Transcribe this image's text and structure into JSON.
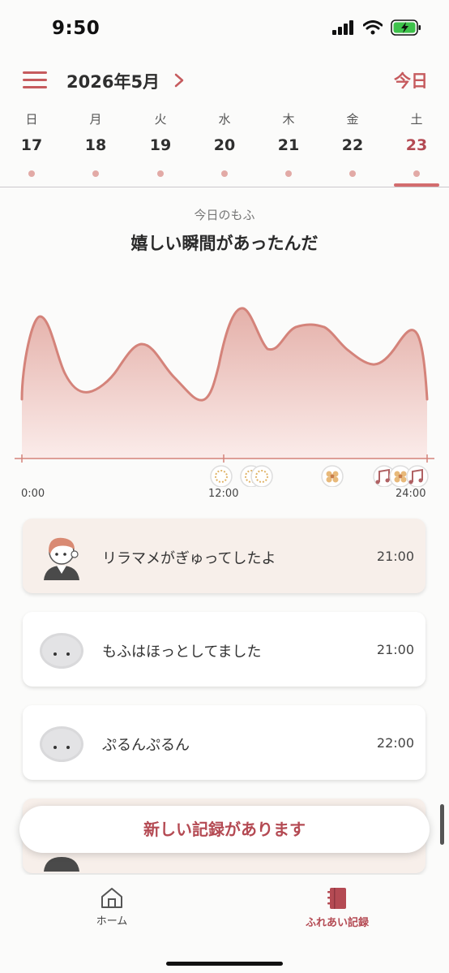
{
  "status": {
    "time": "9:50"
  },
  "header": {
    "month": "2026年5月",
    "today_label": "今日"
  },
  "week": [
    {
      "dow": "日",
      "date": "17",
      "selected": false
    },
    {
      "dow": "月",
      "date": "18",
      "selected": false
    },
    {
      "dow": "火",
      "date": "19",
      "selected": false
    },
    {
      "dow": "水",
      "date": "20",
      "selected": false
    },
    {
      "dow": "木",
      "date": "21",
      "selected": false
    },
    {
      "dow": "金",
      "date": "22",
      "selected": false
    },
    {
      "dow": "土",
      "date": "23",
      "selected": true
    }
  ],
  "mofu": {
    "label": "今日のもふ",
    "title": "嬉しい瞬間があったんだ"
  },
  "chart_data": {
    "type": "area",
    "x_ticks": [
      "0:00",
      "12:00",
      "24:00"
    ],
    "markers": [
      {
        "icon": "sparkle-icon"
      },
      {
        "icon": "sparkle-icon"
      },
      {
        "icon": "sparkle-icon"
      },
      {
        "icon": "flower-icon"
      },
      {
        "icon": "music-note-icon"
      },
      {
        "icon": "flower-icon"
      },
      {
        "icon": "music-note-icon"
      }
    ],
    "colors": {
      "line": "#d4837a",
      "fill_top": "#e4b0a9",
      "fill_bottom": "#fbecea"
    }
  },
  "records": [
    {
      "text": "リラマメがぎゅってしたよ",
      "time": "21:00",
      "avatar": "person-avatar",
      "highlighted": true
    },
    {
      "text": "もふはほっとしてました",
      "time": "21:00",
      "avatar": "mofu-avatar",
      "highlighted": false
    },
    {
      "text": "ぷるんぷるん",
      "time": "22:00",
      "avatar": "mofu-avatar",
      "highlighted": false
    }
  ],
  "toast": {
    "label": "新しい記録があります"
  },
  "nav": {
    "home": "ホーム",
    "records": "ふれあい記録"
  },
  "colors": {
    "accent": "#c65b5e",
    "selected_date": "#b44a53",
    "background": "#fbfbfa"
  }
}
